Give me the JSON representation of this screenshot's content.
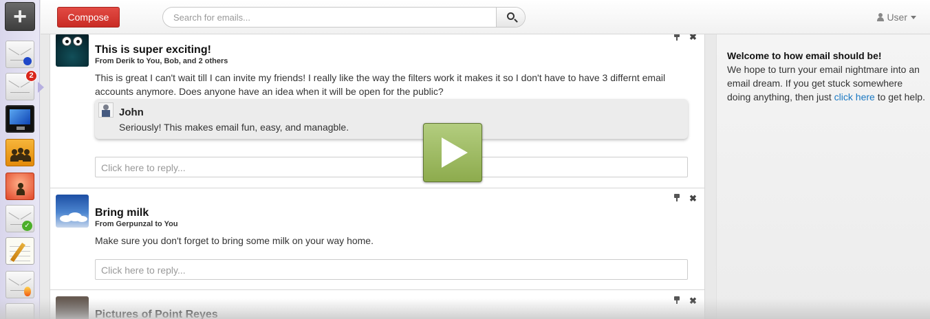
{
  "toolbar": {
    "compose_label": "Compose",
    "search_placeholder": "Search for emails...",
    "user_label": "User"
  },
  "rail": {
    "unread_badge": "2"
  },
  "emails": [
    {
      "subject": "This is super exciting!",
      "from_prefix": "From Derik to You, Bob, and",
      "from_extra": "2 others",
      "body": "This is great I can't wait till I can invite my friends! I really like the way the filters work it makes it so I don't have to have 3 differnt email accounts anymore. Does anyone have an idea when it will be open for the public?",
      "comment": {
        "author": "John",
        "text": "Seriously! This makes email fun, easy, and managble."
      },
      "reply_placeholder": "Click here to reply..."
    },
    {
      "subject": "Bring milk",
      "from_prefix": "From Gerpunzal to You",
      "body": "Make sure you don't forget to bring some milk on your way home.",
      "reply_placeholder": "Click here to reply..."
    },
    {
      "subject": "Pictures of Point Reyes"
    }
  ],
  "sidebar": {
    "title": "Welcome to how email should be!",
    "text_before_link": "We hope to turn your email nightmare into an email dream. If you get stuck somewhere doing anything, then just",
    "link": "click here",
    "text_after_link": "to get help."
  },
  "colors": {
    "compose": "#d93a33",
    "link": "#1a78c2",
    "badge": "#d9261c",
    "play_button": "#a2bd66"
  }
}
